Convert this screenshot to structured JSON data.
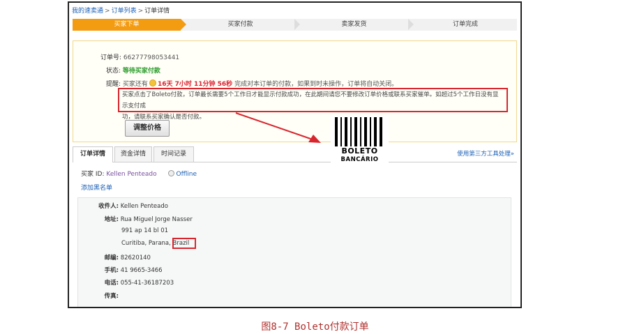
{
  "breadcrumb": {
    "items": [
      "我的速卖通",
      "订单列表",
      "订单详情"
    ],
    "sep": ">"
  },
  "steps": [
    "买家下单",
    "买家付款",
    "卖家发货",
    "订单完成"
  ],
  "order": {
    "order_no_label": "订单号:",
    "order_no": "66277798053441",
    "status_label": "状态:",
    "status": "等待买家付款",
    "reminder_label": "提醒:",
    "reminder_pre": "买家还有",
    "reminder_time": "16天 7小时 11分钟 56秒",
    "reminder_post": "完成对本订单的付款，如果到时未操作，订单将自动关闭。",
    "boleto_line1": "买家点击了Boleto付款，订单最长需要5个工作日才能显示付款成功，在此期间请您不要修改订单价格或联系买家催单。如超过5个工作日没有显示支付成",
    "boleto_line2": "功，请联系买家确认是否付款。",
    "adjust_button": "调整价格"
  },
  "tabs": [
    "订单详情",
    "资金详情",
    "时间记录"
  ],
  "third_party_link": "使用第三方工具处理»",
  "buyer": {
    "label": "买家 ID:",
    "name": "Kellen Penteado",
    "status": "Offline"
  },
  "blacklist_link": "添加黑名单",
  "address": {
    "recipient_label": "收件人:",
    "recipient": "Kellen Penteado",
    "address_label": "地址:",
    "line1": "Rua Miguel Jorge Nasser",
    "line2": "991 ap 14 bl 01",
    "line3_city": "Curitiba, Parana,",
    "line3_country": "Brazil",
    "zip_label": "邮编:",
    "zip": "82620140",
    "mobile_label": "手机:",
    "mobile": "41 9665-3466",
    "phone_label": "电话:",
    "phone": "055-41-36187203",
    "fax_label": "传真:"
  },
  "boleto_logo": {
    "line1": "BOLETO",
    "line2": "BANCÁRIO"
  },
  "caption": "图8-7 Boleto付款订单",
  "colors": {
    "accent": "#f39c12",
    "highlight": "#d8262e",
    "link": "#1a5fb4",
    "caption": "#b0312e"
  }
}
